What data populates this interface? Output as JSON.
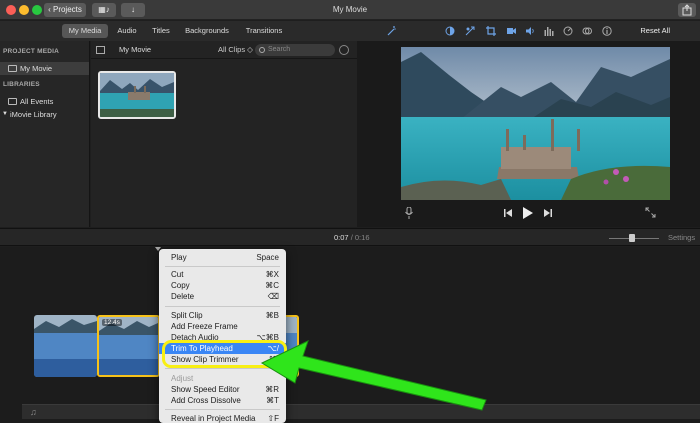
{
  "window": {
    "title": "My Movie",
    "projects_label": "Projects"
  },
  "tabs": [
    {
      "label": "My Media",
      "active": true
    },
    {
      "label": "Audio",
      "active": false
    },
    {
      "label": "Titles",
      "active": false
    },
    {
      "label": "Backgrounds",
      "active": false
    },
    {
      "label": "Transitions",
      "active": false
    }
  ],
  "sidebar": {
    "project_media_heading": "PROJECT MEDIA",
    "project_item": "My Movie",
    "libraries_heading": "LIBRARIES",
    "all_events": "All Events",
    "library": "iMovie Library"
  },
  "browser": {
    "title": "My Movie",
    "filter": "All Clips",
    "search_placeholder": "Search"
  },
  "viewer": {
    "reset_all": "Reset All",
    "icons": [
      "magic-wand-icon",
      "color-balance-icon",
      "color-correction-icon",
      "crop-icon",
      "stabilization-icon",
      "volume-icon",
      "equalizer-icon",
      "speed-icon",
      "filter-icon",
      "info-icon"
    ]
  },
  "timeline": {
    "current_time": "0:07",
    "separator": "/",
    "total_time": "0:16",
    "settings_label": "Settings",
    "selected_clip_label": "12.4s"
  },
  "context_menu": {
    "items": [
      {
        "label": "Play",
        "shortcut": "Space",
        "enabled": true
      },
      {
        "label": "Cut",
        "shortcut": "⌘X",
        "enabled": true
      },
      {
        "label": "Copy",
        "shortcut": "⌘C",
        "enabled": true
      },
      {
        "label": "Delete",
        "shortcut": "⌫",
        "enabled": true
      },
      {
        "label": "Split Clip",
        "shortcut": "⌘B",
        "enabled": true
      },
      {
        "label": "Add Freeze Frame",
        "shortcut": "",
        "enabled": true
      },
      {
        "label": "Detach Audio",
        "shortcut": "⌥⌘B",
        "enabled": true
      },
      {
        "label": "Trim To Playhead",
        "shortcut": "⌥/",
        "enabled": true,
        "highlighted": true
      },
      {
        "label": "Show Clip Trimmer",
        "shortcut": "⌘\\",
        "enabled": true
      },
      {
        "label": "Adjust",
        "shortcut": "",
        "enabled": false
      },
      {
        "label": "Show Speed Editor",
        "shortcut": "⌘R",
        "enabled": true
      },
      {
        "label": "Add Cross Dissolve",
        "shortcut": "⌘T",
        "enabled": true
      },
      {
        "label": "Reveal in Project Media",
        "shortcut": "⇧F",
        "enabled": true
      }
    ]
  },
  "colors": {
    "selection_border": "#f6c21a",
    "highlight_ring": "#f8ef13",
    "annotation_arrow": "#2fe51b",
    "menu_highlight": "#3a86f5"
  }
}
